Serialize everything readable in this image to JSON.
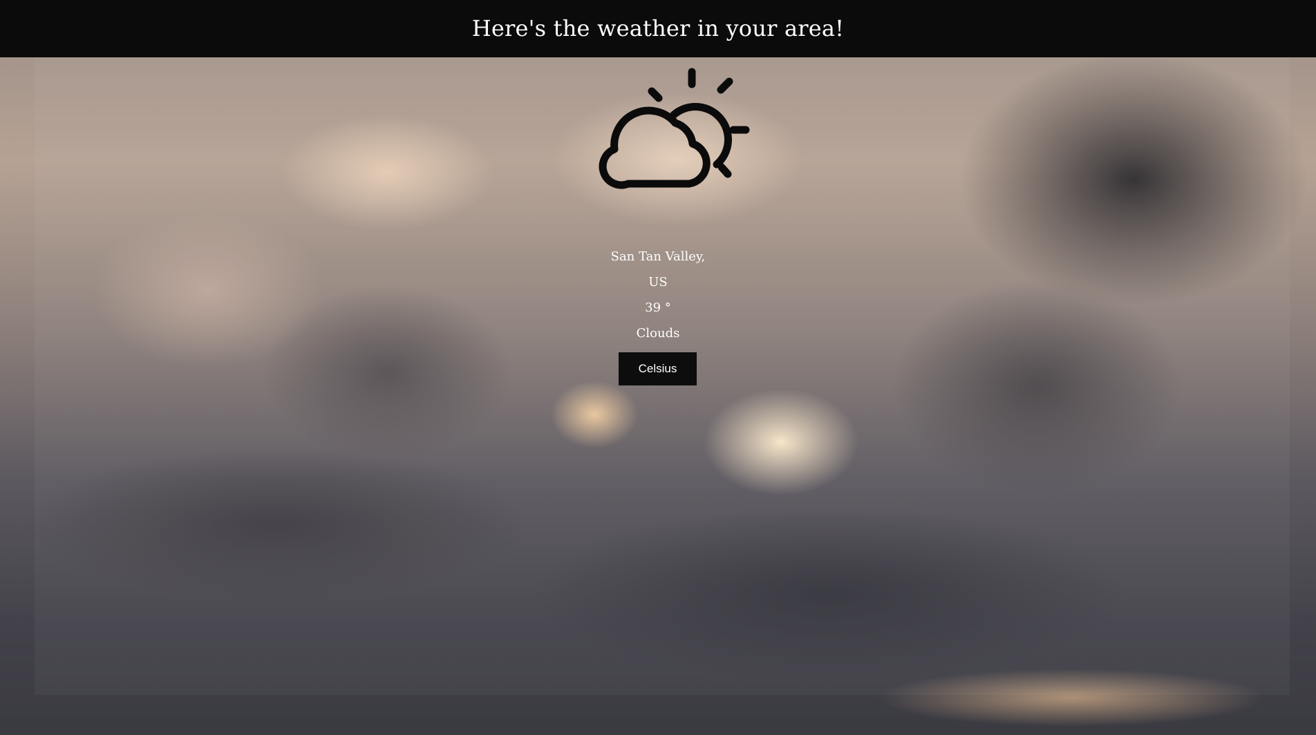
{
  "header": {
    "title": "Here's the weather in your area!"
  },
  "weather": {
    "icon": "partly-cloudy-icon",
    "city": "San Tan Valley,",
    "country": "US",
    "temperature": "39 °",
    "condition": "Clouds",
    "unit_button_label": "Celsius"
  }
}
